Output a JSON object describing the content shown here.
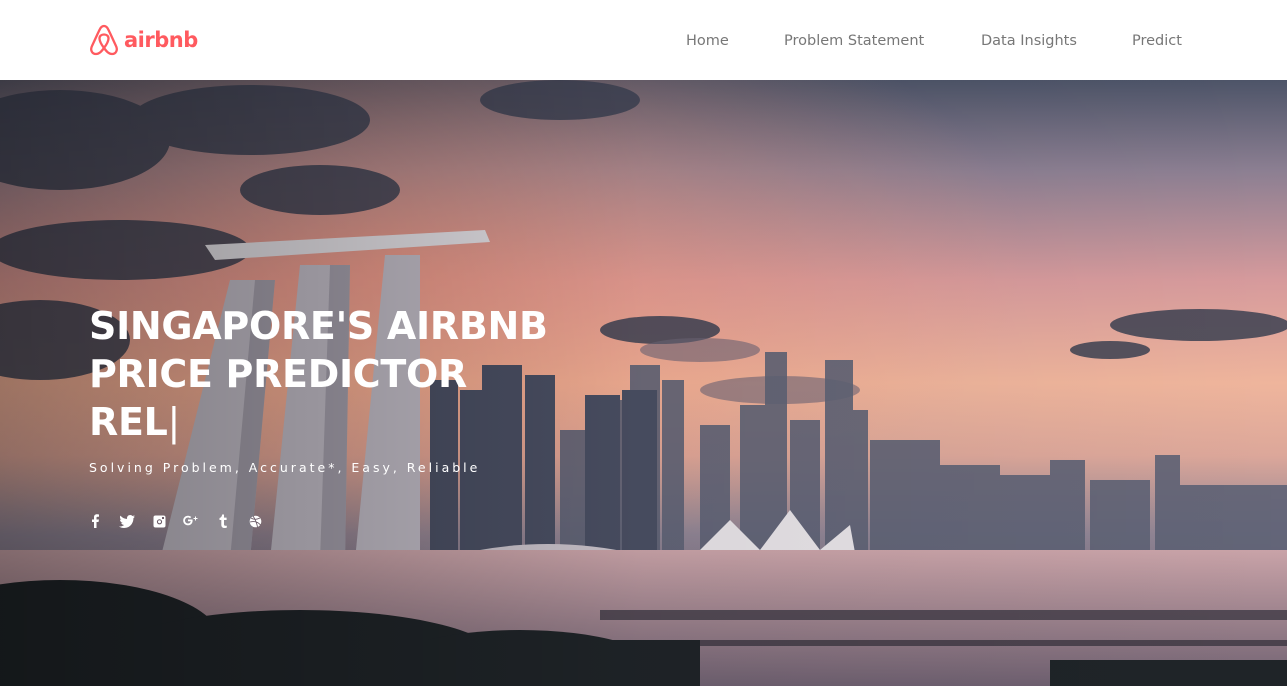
{
  "brand": {
    "name": "airbnb",
    "color": "#ff5a5f"
  },
  "nav": {
    "items": [
      {
        "label": "Home"
      },
      {
        "label": "Problem Statement"
      },
      {
        "label": "Data Insights"
      },
      {
        "label": "Predict"
      }
    ]
  },
  "hero": {
    "title_lines": [
      "SINGAPORE'S AIRBNB",
      "PRICE PREDICTOR",
      "REL"
    ],
    "cursor": "|",
    "subtitle": "Solving Problem, Accurate*, Easy, Reliable",
    "background": "singapore-skyline-sunset-photo"
  },
  "social": [
    {
      "icon": "facebook-icon"
    },
    {
      "icon": "twitter-icon"
    },
    {
      "icon": "instagram-icon"
    },
    {
      "icon": "google-plus-icon"
    },
    {
      "icon": "tumblr-icon"
    },
    {
      "icon": "dribbble-icon"
    }
  ]
}
